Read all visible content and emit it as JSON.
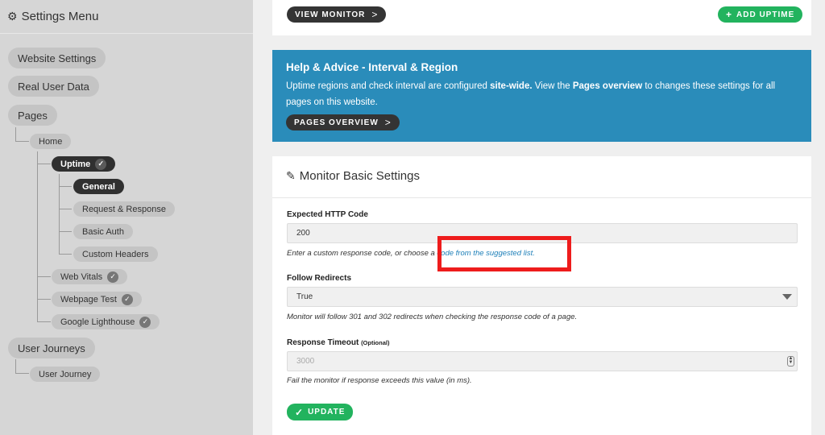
{
  "sidebar": {
    "title": "Settings Menu",
    "items": {
      "website_settings": "Website Settings",
      "real_user_data": "Real User Data",
      "pages": "Pages",
      "home": "Home",
      "uptime": "Uptime",
      "general": "General",
      "request_response": "Request & Response",
      "basic_auth": "Basic Auth",
      "custom_headers": "Custom Headers",
      "web_vitals": "Web Vitals",
      "webpage_test": "Webpage Test",
      "google_lighthouse": "Google Lighthouse",
      "user_journeys": "User Journeys",
      "user_journey": "User Journey"
    }
  },
  "top": {
    "view_monitor": "VIEW MONITOR",
    "add_uptime": "ADD UPTIME"
  },
  "help": {
    "title": "Help & Advice - Interval & Region",
    "text_a": "Uptime regions and check interval are configured ",
    "text_b": "site-wide.",
    "text_c": " View the ",
    "text_d": "Pages overview",
    "text_e": " to changes these settings for all pages on this website.",
    "button": "PAGES OVERVIEW"
  },
  "monitor": {
    "title": "Monitor Basic Settings",
    "http_code": {
      "label": "Expected HTTP Code",
      "value": "200",
      "help_prefix": "Enter a custom response code, or choose a ",
      "help_link": "code from the suggested list."
    },
    "redirects": {
      "label": "Follow Redirects",
      "value": "True",
      "help": "Monitor will follow 301 and 302 redirects when checking the response code of a page."
    },
    "timeout": {
      "label": "Response Timeout",
      "optional": "(Optional)",
      "placeholder": "3000",
      "help": "Fail the monitor if response exceeds this value (in ms)."
    },
    "update_button": "UPDATE"
  },
  "icons": {
    "gear": "gear-icon",
    "check": "check-icon",
    "chevron": "chevron-right-icon",
    "plus": "plus-icon",
    "pencil": "pencil-icon",
    "caret": "caret-down-icon"
  },
  "colors": {
    "accent_blue": "#2a8cba",
    "green": "#22b35e",
    "highlight_red": "#ee1c1c"
  }
}
